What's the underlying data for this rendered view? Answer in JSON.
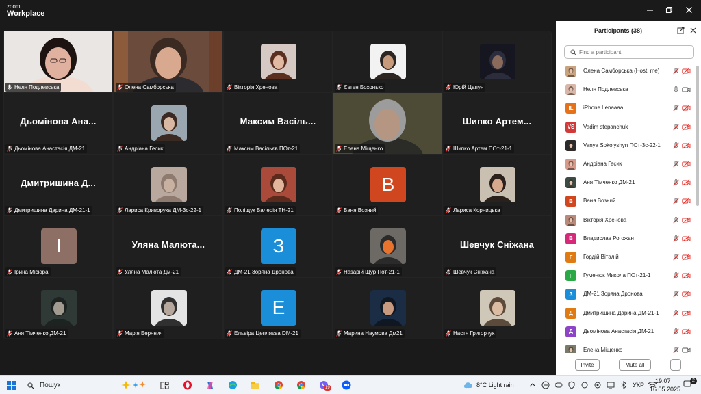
{
  "app": {
    "logo_top": "zoom",
    "logo_bottom": "Workplace"
  },
  "grid": {
    "tiles": [
      {
        "name": "Неля Подлевська",
        "type": "video",
        "active": true,
        "mic": "on"
      },
      {
        "name": "Олена Самборська",
        "type": "video",
        "mic": "muted"
      },
      {
        "name": "Вікторія Хренова",
        "type": "photo",
        "mic": "muted"
      },
      {
        "name": "Євген Бохонько",
        "type": "photo",
        "mic": "muted"
      },
      {
        "name": "Юрій Цапун",
        "type": "photo",
        "mic": "muted"
      },
      {
        "name": "Дьомінова Анастасія ДМ-21",
        "type": "name",
        "display": "Дьомінова  Ана...",
        "mic": "muted"
      },
      {
        "name": "Андріана Гесик",
        "type": "photo",
        "mic": "muted"
      },
      {
        "name": "Максим Васільєв ПОт-21",
        "type": "name",
        "display": "Максим  Васіль...",
        "mic": "muted"
      },
      {
        "name": "Елена Міщенко",
        "type": "video",
        "mic": "muted"
      },
      {
        "name": "Шипко Артем ПОт-21-1",
        "type": "name",
        "display": "Шипко  Артем...",
        "mic": "muted"
      },
      {
        "name": "Дмитришина Дарина ДМ-21-1",
        "type": "name",
        "display": "Дмитришина  Д...",
        "mic": "muted"
      },
      {
        "name": "Лариса Криворука ДМ-3с-22-1",
        "type": "photo",
        "mic": "muted"
      },
      {
        "name": "Поліщук Валерія ТН-21",
        "type": "photo",
        "mic": "muted"
      },
      {
        "name": "Ваня Возний",
        "type": "letter",
        "letter": "B",
        "color": "#d0461f",
        "mic": "muted"
      },
      {
        "name": "Лариса Корницька",
        "type": "photo",
        "mic": "muted"
      },
      {
        "name": "Ірина Місюра",
        "type": "letter",
        "letter": "I",
        "color": "#8e6f65",
        "mic": "muted"
      },
      {
        "name": "Уляна Малюта Дм-21",
        "type": "name",
        "display": "Уляна  Малюта...",
        "mic": "muted"
      },
      {
        "name": "ДМ-21 Зоряна  Дронова",
        "type": "letter",
        "letter": "З",
        "color": "#1a8ed9",
        "mic": "muted"
      },
      {
        "name": "Назарій Щур Пот-21-1",
        "type": "photo",
        "mic": "muted"
      },
      {
        "name": "Шевчук Сніжана",
        "type": "name",
        "display": "Шевчук  Сніжана",
        "mic": "muted"
      },
      {
        "name": "Аня Тімченко ДМ-21",
        "type": "photo",
        "mic": "muted"
      },
      {
        "name": "Марія Берянич",
        "type": "photo",
        "mic": "muted"
      },
      {
        "name": "Ельвіра Цепляєва DM-21",
        "type": "letter",
        "letter": "E",
        "color": "#1a8ed9",
        "mic": "muted"
      },
      {
        "name": "Марина Наумова Дм21",
        "type": "photo",
        "mic": "muted"
      },
      {
        "name": "Настя Григорчук",
        "type": "photo",
        "mic": "muted"
      }
    ]
  },
  "panel": {
    "title": "Participants (38)",
    "search_placeholder": "Find a participant",
    "participants": [
      {
        "name": "Олена Самборська (Host, me)",
        "avatar": "photo",
        "color": "#c9a27e",
        "mic": "muted",
        "cam": "off"
      },
      {
        "name": "Неля Подлевська",
        "avatar": "photo",
        "color": "#d8b7a9",
        "mic": "on",
        "cam": "on"
      },
      {
        "name": "iPhone Lenaaaa",
        "avatar": "letter",
        "letter": "IL",
        "color": "#e5711a",
        "mic": "muted",
        "cam": "off"
      },
      {
        "name": "Vadim stepanchuk",
        "avatar": "letter",
        "letter": "VS",
        "color": "#d23a3a",
        "mic": "muted",
        "cam": "off"
      },
      {
        "name": "Vanya Sokolyshyn ПОт-3с-22-1",
        "avatar": "photo",
        "color": "#2a2a2a",
        "mic": "muted",
        "cam": "off"
      },
      {
        "name": "Андріана Гесик",
        "avatar": "photo",
        "color": "#d79a8a",
        "mic": "muted",
        "cam": "off"
      },
      {
        "name": "Аня Тімченко ДМ-21",
        "avatar": "photo",
        "color": "#3d4b45",
        "mic": "muted",
        "cam": "off"
      },
      {
        "name": "Ваня Возний",
        "avatar": "letter",
        "letter": "B",
        "color": "#d0461f",
        "mic": "muted",
        "cam": "off"
      },
      {
        "name": "Вікторія Хренова",
        "avatar": "photo",
        "color": "#b98a7a",
        "mic": "muted",
        "cam": "off"
      },
      {
        "name": "Владислав Рогожан",
        "avatar": "letter",
        "letter": "B",
        "color": "#d6297a",
        "mic": "muted",
        "cam": "off"
      },
      {
        "name": "Гордій Віталій",
        "avatar": "letter",
        "letter": "Г",
        "color": "#e07a12",
        "mic": "muted",
        "cam": "off"
      },
      {
        "name": "Гуменюк Микола ПОт-21-1",
        "avatar": "letter",
        "letter": "Г",
        "color": "#29a845",
        "mic": "muted",
        "cam": "off"
      },
      {
        "name": "ДМ-21 Зоряна  Дронова",
        "avatar": "letter",
        "letter": "З",
        "color": "#1a8ed9",
        "mic": "muted",
        "cam": "off"
      },
      {
        "name": "Дмитришина Дарина ДМ-21-1",
        "avatar": "letter",
        "letter": "Д",
        "color": "#e07a12",
        "mic": "muted",
        "cam": "off"
      },
      {
        "name": "Дьомінова Анастасія ДМ-21",
        "avatar": "letter",
        "letter": "Д",
        "color": "#8e44c6",
        "mic": "muted",
        "cam": "off"
      },
      {
        "name": "Елена Міщенко",
        "avatar": "photo",
        "color": "#7a7a6a",
        "mic": "muted",
        "cam": "on"
      }
    ],
    "invite_label": "Invite",
    "mute_all_label": "Mute all",
    "more_label": "···"
  },
  "taskbar": {
    "search_placeholder": "Пошук",
    "weather": "8°C  Light rain",
    "language": "УКР",
    "time": "19:07",
    "date": "16.05.2025",
    "notifications_count": "2",
    "badge_count": "19"
  }
}
